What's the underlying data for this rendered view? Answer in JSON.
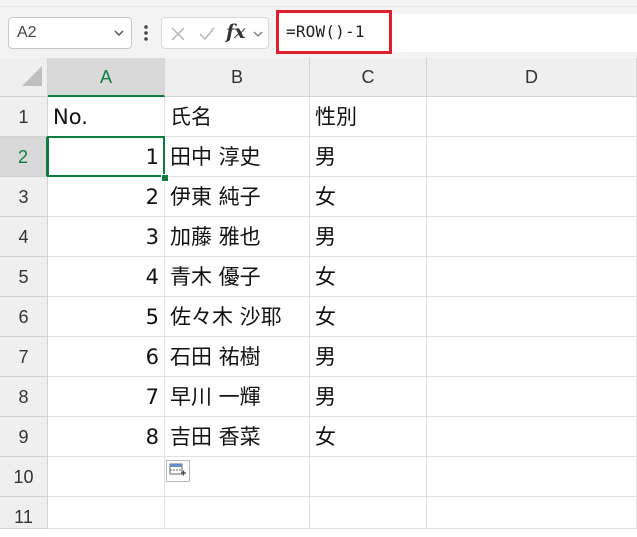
{
  "formula_bar": {
    "name_box": "A2",
    "formula": "=ROW()-1",
    "fx_label": "fx",
    "icons": [
      "chevron-down-icon",
      "more-vertical-icon",
      "cancel-x-icon",
      "enter-check-icon",
      "fx-icon",
      "chevron-down-icon"
    ]
  },
  "columns": [
    "A",
    "B",
    "C",
    "D"
  ],
  "rows": [
    "1",
    "2",
    "3",
    "4",
    "5",
    "6",
    "7",
    "8",
    "9",
    "10",
    "11"
  ],
  "cells": [
    [
      "No.",
      "氏名",
      "性別"
    ],
    [
      "1",
      "田中 淳史",
      "男"
    ],
    [
      "2",
      "伊東 純子",
      "女"
    ],
    [
      "3",
      "加藤 雅也",
      "男"
    ],
    [
      "4",
      "青木 優子",
      "女"
    ],
    [
      "5",
      "佐々木 沙耶",
      "女"
    ],
    [
      "6",
      "石田 祐樹",
      "男"
    ],
    [
      "7",
      "早川 一輝",
      "男"
    ],
    [
      "8",
      "吉田 香菜",
      "女"
    ]
  ],
  "selection": {
    "active_cell": "A2",
    "column": "A",
    "row": "2"
  },
  "colors": {
    "accent": "#107c41",
    "highlight": "#e0212d"
  },
  "quick_analysis": {
    "icon": "paste-options-icon"
  }
}
